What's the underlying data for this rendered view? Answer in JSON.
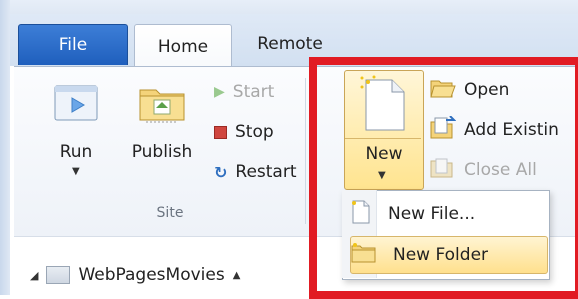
{
  "tabs": {
    "file": "File",
    "home": "Home",
    "remote": "Remote"
  },
  "ribbon": {
    "site_group_label": "Site",
    "run_label": "Run",
    "publish_label": "Publish",
    "start_label": "Start",
    "stop_label": "Stop",
    "restart_label": "Restart",
    "new_label": "New",
    "open_label": "Open",
    "add_existing_label": "Add Existin",
    "close_all_label": "Close All"
  },
  "menu": {
    "new_file": "New File...",
    "new_folder": "New Folder"
  },
  "tree": {
    "root_label": "WebPagesMovies"
  },
  "colors": {
    "highlight_frame": "#e11b23",
    "file_tab": "#2a6ac9",
    "hover_gold": "#ffe48f"
  }
}
